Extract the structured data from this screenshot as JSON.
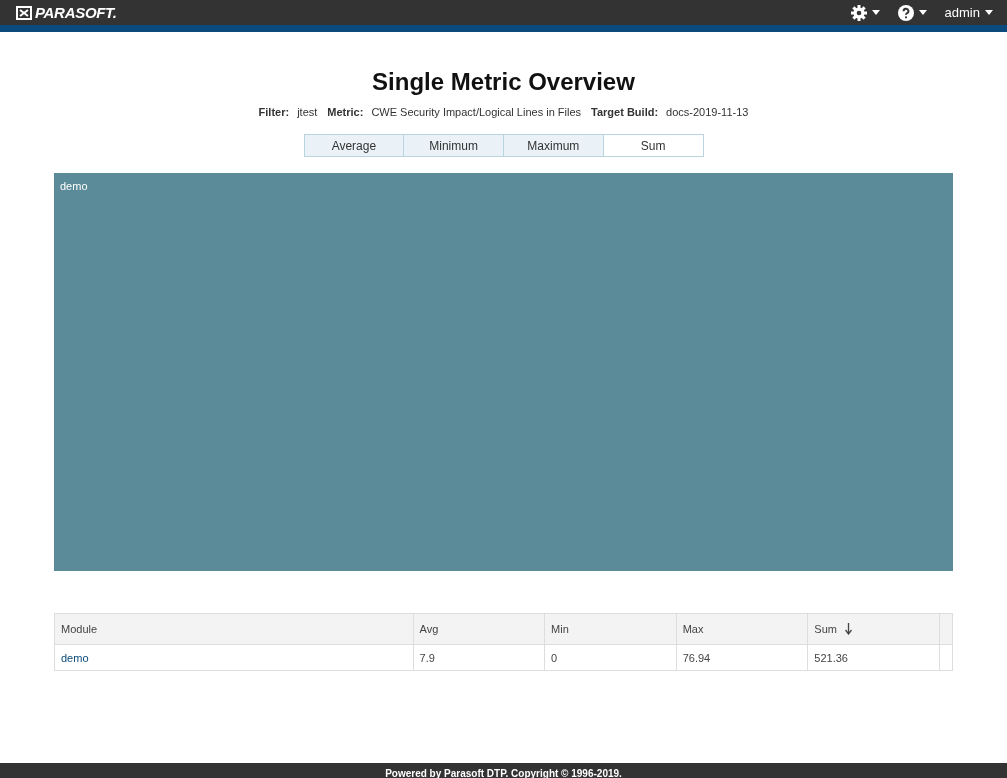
{
  "header": {
    "logo": "PARASOFT.",
    "user": "admin"
  },
  "title": "Single Metric Overview",
  "info": [
    {
      "label": "Filter:",
      "value": "jtest"
    },
    {
      "label": "Metric:",
      "value": "CWE Security Impact/Logical Lines in Files"
    },
    {
      "label": "Target Build:",
      "value": "docs-2019-11-13"
    }
  ],
  "tabs": [
    {
      "label": "Average",
      "selected": false
    },
    {
      "label": "Minimum",
      "selected": false
    },
    {
      "label": "Maximum",
      "selected": false
    },
    {
      "label": "Sum",
      "selected": true
    }
  ],
  "treemap": {
    "label": "demo"
  },
  "table": {
    "columns": [
      {
        "label": "Module",
        "sorted": false
      },
      {
        "label": "Avg",
        "sorted": false
      },
      {
        "label": "Min",
        "sorted": false
      },
      {
        "label": "Max",
        "sorted": false
      },
      {
        "label": "Sum",
        "sorted": true
      }
    ],
    "rows": [
      {
        "cells": [
          "demo",
          "7.9",
          "0",
          "76.94",
          "521.36"
        ]
      }
    ]
  },
  "footer": "Powered by Parasoft DTP. Copyright © 1996-2019."
}
